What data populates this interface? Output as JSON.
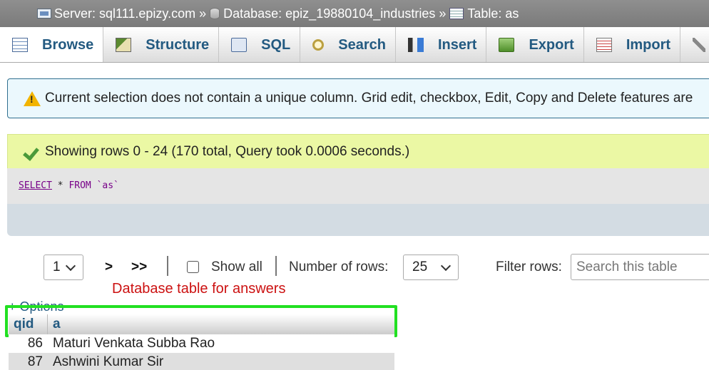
{
  "breadcrumb": {
    "server": "Server: sql111.epizy.com",
    "database": "Database: epiz_19880104_industries",
    "table": "Table: as",
    "separator": "»"
  },
  "tabs": [
    {
      "label": "Browse",
      "icon": "browse-icon"
    },
    {
      "label": "Structure",
      "icon": "structure-icon"
    },
    {
      "label": "SQL",
      "icon": "sql-icon"
    },
    {
      "label": "Search",
      "icon": "search-icon"
    },
    {
      "label": "Insert",
      "icon": "insert-icon"
    },
    {
      "label": "Export",
      "icon": "export-icon"
    },
    {
      "label": "Import",
      "icon": "import-icon"
    }
  ],
  "warning": {
    "text": "Current selection does not contain a unique column. Grid edit, checkbox, Edit, Copy and Delete features are"
  },
  "success": {
    "text": "Showing rows 0 - 24 (170 total, Query took 0.0006 seconds.)"
  },
  "query": {
    "select": "SELECT",
    "star": "*",
    "from": "FROM",
    "table": "`as`"
  },
  "navigation": {
    "page": "1",
    "next": ">",
    "last": ">>",
    "show_all": "Show all",
    "rows_label": "Number of rows:",
    "rows_value": "25",
    "filter_label": "Filter rows:",
    "filter_placeholder": "Search this table"
  },
  "annotation": "Database table for answers",
  "options_link": "+ Options",
  "table": {
    "columns": [
      "qid",
      "a"
    ],
    "rows": [
      [
        "86",
        "Maturi Venkata Subba Rao"
      ],
      [
        "87",
        "Ashwini Kumar Sir"
      ]
    ]
  },
  "colors": {
    "warning_bg": "#ebf8fd",
    "success_bg": "#ebf8a4",
    "annotation": "#cc1111",
    "highlight": "#22e022"
  }
}
